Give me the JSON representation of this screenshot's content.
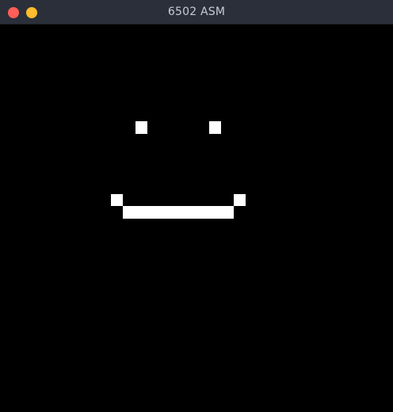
{
  "window": {
    "title": "6502 ASM",
    "buttons": {
      "close_color": "#ff5f57",
      "minimize_color": "#febc2e"
    }
  },
  "display": {
    "columns": 32,
    "rows": 32,
    "background_color": "#000000",
    "on_color": "#ffffff",
    "lit_pixels": [
      {
        "col": 11,
        "row": 8
      },
      {
        "col": 17,
        "row": 8
      },
      {
        "col": 9,
        "row": 14
      },
      {
        "col": 19,
        "row": 14
      },
      {
        "col": 10,
        "row": 15
      },
      {
        "col": 11,
        "row": 15
      },
      {
        "col": 12,
        "row": 15
      },
      {
        "col": 13,
        "row": 15
      },
      {
        "col": 14,
        "row": 15
      },
      {
        "col": 15,
        "row": 15
      },
      {
        "col": 16,
        "row": 15
      },
      {
        "col": 17,
        "row": 15
      },
      {
        "col": 18,
        "row": 15
      }
    ]
  }
}
